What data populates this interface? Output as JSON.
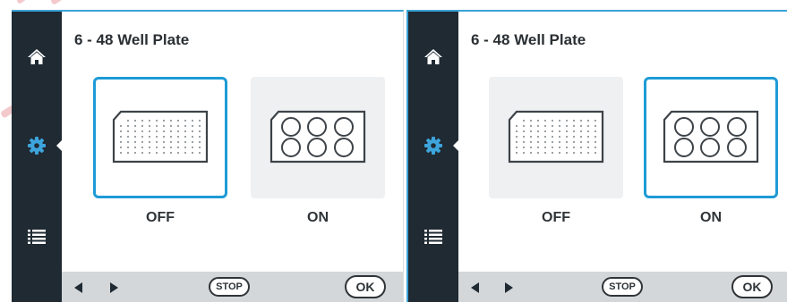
{
  "screens": [
    {
      "id": "left",
      "title": "6 - 48 Well Plate",
      "selected": "OFF",
      "options": [
        {
          "label": "OFF",
          "icon": "plate-96-well-icon",
          "selected": true
        },
        {
          "label": "ON",
          "icon": "plate-6-well-icon",
          "selected": false
        }
      ],
      "footer": {
        "stop_label": "STOP",
        "ok_label": "OK"
      }
    },
    {
      "id": "right",
      "title": "6 - 48 Well Plate",
      "selected": "ON",
      "options": [
        {
          "label": "OFF",
          "icon": "plate-96-well-icon",
          "selected": false
        },
        {
          "label": "ON",
          "icon": "plate-6-well-icon",
          "selected": true
        }
      ],
      "footer": {
        "stop_label": "STOP",
        "ok_label": "OK"
      }
    }
  ],
  "sidebar_items": [
    {
      "icon": "home-icon"
    },
    {
      "icon": "gear-icon",
      "active": true
    },
    {
      "icon": "list-icon"
    }
  ],
  "colors": {
    "sidebar": "#1f2a33",
    "accent": "#1e9bd6",
    "footer": "#d4d7d9",
    "option_bg": "#eef0f1"
  }
}
